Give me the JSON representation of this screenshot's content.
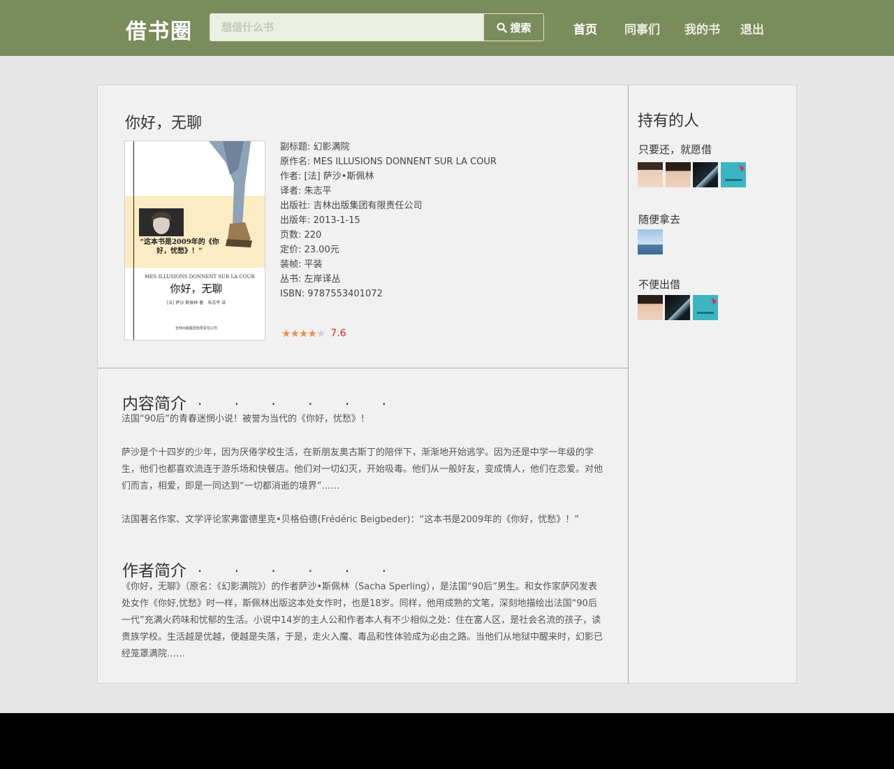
{
  "header": {
    "logo": "借书圈",
    "search_placeholder": "想借什么书",
    "search_button": "搜索",
    "nav": [
      "首页",
      "同事们",
      "我的书",
      "退出"
    ]
  },
  "book": {
    "title": "你好，无聊",
    "cover": {
      "quote": "“这本书是2009年的《你好，忧愁》！”",
      "en_title": "MES ILLUSIONS DONNENT SUR LA COUR",
      "cn_title": "你好，无聊",
      "authors": "[法] 萨沙·斯佩林 著　朱志平 译",
      "publisher": "吉林出版集团有限责任公司"
    },
    "info": [
      "副标题: 幻影满院",
      "原作名: MES ILLUSIONS DONNENT SUR LA COUR",
      "作者: [法] 萨沙•斯佩林",
      "译者: 朱志平",
      "出版社: 吉林出版集团有限责任公司",
      "出版年: 2013-1-15",
      "页数: 220",
      "定价: 23.00元",
      "装帧: 平装",
      "丛书: 左岸译丛",
      "ISBN: 9787553401072"
    ],
    "rating": {
      "stars": 4,
      "max_stars": 5,
      "score": "7.6"
    }
  },
  "content_intro": {
    "heading": "内容简介",
    "dots": "· · · · · ·",
    "paragraphs": [
      "法国“90后”的青春迷惘小说！被誉为当代的《你好，忧愁》！",
      "萨沙是个十四岁的少年，因为厌倦学校生活，在新朋友奥古斯丁的陪伴下，渐渐地开始逃学。因为还是中学一年级的学生，他们也都喜欢流连于游乐场和快餐店。他们对一切幻灭，开始吸毒。他们从一般好友，变成情人，他们在恋爱。对他们而言，相爱，即是一同达到“一切都消逝的境界”……",
      "法国著名作家、文学评论家弗雷德里克•贝格伯德(Frédéric Beigbeder)：“这本书是2009年的《你好，忧愁》！”"
    ]
  },
  "author_intro": {
    "heading": "作者简介",
    "dots": "· · · · · ·",
    "paragraph": "《你好，无聊》（原名：《幻影满院》）的作者萨沙•斯佩林（Sacha Sperling），是法国“90后”男生。和女作家萨冈发表处女作《你好,忧愁》时一样，斯佩林出版这本处女作时，也是18岁。同样，他用成熟的文笔，深刻地描绘出法国“90后一代”充满火药味和忧郁的生活。小说中14岁的主人公和作者本人有不少相似之处：住在富人区，是社会名流的孩子，读贵族学校。生活越是优越，便越是失落，于是，走火入魔、毒品和性体验成为必由之路。当他们从地狱中醒来时，幻影已经笼罩满院……"
  },
  "sidebar": {
    "title": "持有的人",
    "groups": [
      {
        "label": "只要还，就愿借",
        "avatars": [
          "girl-avatar",
          "girl-avatar",
          "dark-avatar",
          "book-avatar"
        ]
      },
      {
        "label": "随便拿去",
        "avatars": [
          "sky-avatar"
        ]
      },
      {
        "label": "不便出借",
        "avatars": [
          "girl-avatar",
          "dark-avatar",
          "book-avatar"
        ]
      }
    ]
  },
  "colors": {
    "header_bg": "#7b8c5c",
    "page_bg": "#e6e6e6",
    "card_bg": "#f1f1f1",
    "rating_star": "#f08a4b",
    "rating_score": "#e7251e"
  }
}
